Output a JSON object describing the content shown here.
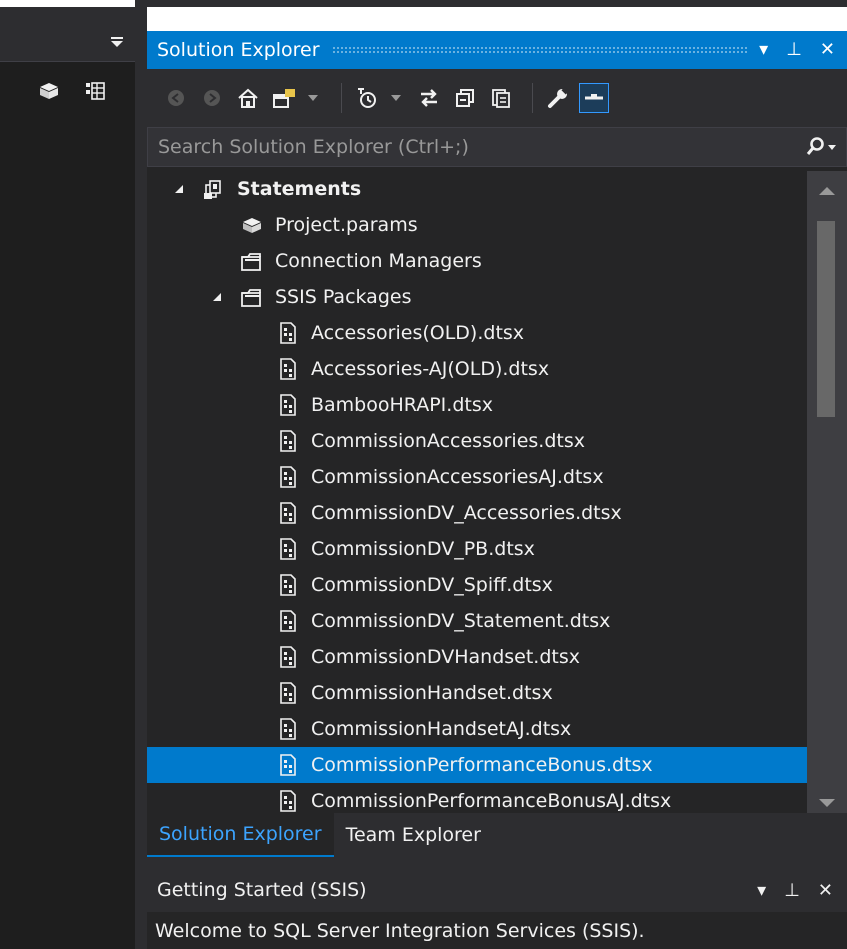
{
  "solution_explorer": {
    "title": "Solution Explorer",
    "search_placeholder": "Search Solution Explorer (Ctrl+;)",
    "tree": [
      {
        "label": "Statements",
        "level": 0,
        "expanded": true,
        "icon": "solution-icon",
        "bold": true
      },
      {
        "label": "Project.params",
        "level": 1,
        "icon": "params-icon"
      },
      {
        "label": "Connection Managers",
        "level": 1,
        "icon": "folder-icon"
      },
      {
        "label": "SSIS Packages",
        "level": 1,
        "expanded": true,
        "icon": "folder-icon"
      },
      {
        "label": "Accessories(OLD).dtsx",
        "level": 2,
        "icon": "package-icon"
      },
      {
        "label": "Accessories-AJ(OLD).dtsx",
        "level": 2,
        "icon": "package-icon"
      },
      {
        "label": "BambooHRAPI.dtsx",
        "level": 2,
        "icon": "package-icon"
      },
      {
        "label": "CommissionAccessories.dtsx",
        "level": 2,
        "icon": "package-icon"
      },
      {
        "label": "CommissionAccessoriesAJ.dtsx",
        "level": 2,
        "icon": "package-icon"
      },
      {
        "label": "CommissionDV_Accessories.dtsx",
        "level": 2,
        "icon": "package-icon"
      },
      {
        "label": "CommissionDV_PB.dtsx",
        "level": 2,
        "icon": "package-icon"
      },
      {
        "label": "CommissionDV_Spiff.dtsx",
        "level": 2,
        "icon": "package-icon"
      },
      {
        "label": "CommissionDV_Statement.dtsx",
        "level": 2,
        "icon": "package-icon"
      },
      {
        "label": "CommissionDVHandset.dtsx",
        "level": 2,
        "icon": "package-icon"
      },
      {
        "label": "CommissionHandset.dtsx",
        "level": 2,
        "icon": "package-icon"
      },
      {
        "label": "CommissionHandsetAJ.dtsx",
        "level": 2,
        "icon": "package-icon"
      },
      {
        "label": "CommissionPerformanceBonus.dtsx",
        "level": 2,
        "icon": "package-icon",
        "selected": true
      },
      {
        "label": "CommissionPerformanceBonusAJ.dtsx",
        "level": 2,
        "icon": "package-icon"
      }
    ],
    "tabs": [
      {
        "label": "Solution Explorer",
        "active": true
      },
      {
        "label": "Team Explorer",
        "active": false
      }
    ]
  },
  "getting_started": {
    "title": "Getting Started (SSIS)",
    "welcome": "Welcome to SQL Server Integration Services (SSIS)."
  },
  "colors": {
    "accent": "#007acc",
    "background": "#252526",
    "selection": "#007acc"
  }
}
